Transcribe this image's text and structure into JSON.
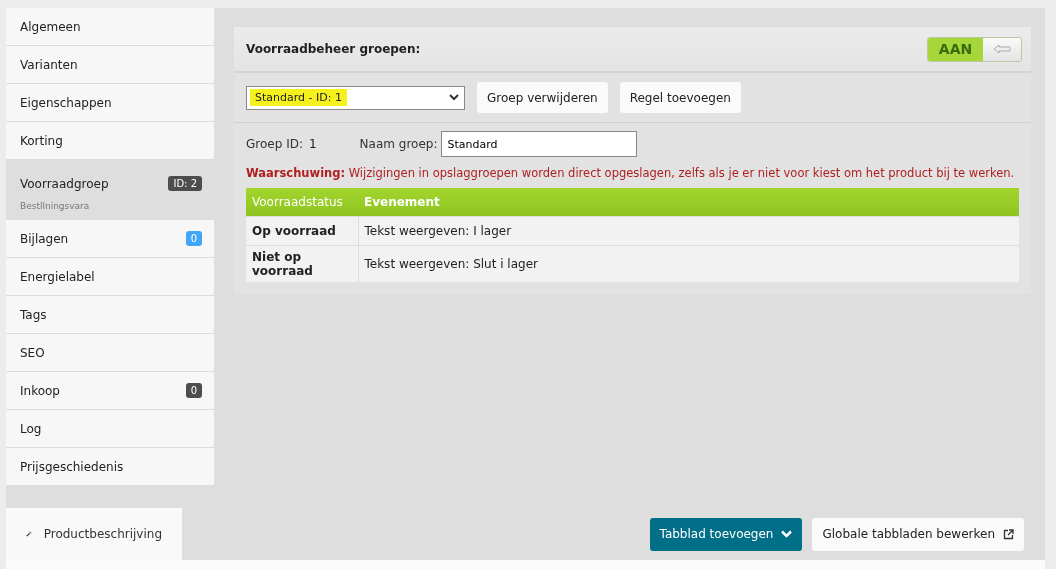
{
  "sidebar": {
    "items": [
      {
        "label": "Algemeen",
        "selected": false
      },
      {
        "label": "Varianten",
        "selected": false
      },
      {
        "label": "Eigenschappen",
        "selected": false
      },
      {
        "label": "Korting",
        "selected": false
      },
      {
        "label": "Voorraadgroep",
        "selected": true,
        "badge": "ID: 2",
        "color": "#4d4d4d",
        "subtitle": "Bestllningsvara"
      },
      {
        "label": "Bijlagen",
        "selected": false,
        "badge": "0",
        "color": "#42a5f5"
      },
      {
        "label": "Energielabel",
        "selected": false
      },
      {
        "label": "Tags",
        "selected": false
      },
      {
        "label": "SEO",
        "selected": false
      },
      {
        "label": "Inkoop",
        "selected": false,
        "badge": "0",
        "color": "#4d4d4d"
      },
      {
        "label": "Log",
        "selected": false
      },
      {
        "label": "Prijsgeschiedenis",
        "selected": false
      }
    ]
  },
  "panel": {
    "title": "Voorraadbeheer groepen:",
    "toggle": {
      "label": "AAN",
      "on": true
    },
    "group_select": {
      "value": "Standard - ID: 1",
      "highlighted": true
    },
    "buttons": [
      "Groep verwijderen",
      "Regel toevoegen"
    ],
    "group_id_label": "Groep ID:",
    "group_id": "1",
    "name_label": "Naam groep:",
    "name_value": "Standard",
    "warning": "**Waarschuwing:** Wijzigingen in opslaggroepen worden direct opgeslagen, zelfs als je er niet voor kiest om het product bij te werken.",
    "table": {
      "columns": [
        "Voorraadstatus",
        "Evenement"
      ],
      "rows": [
        [
          "Op voorraad",
          "Tekst weergeven: I lager"
        ],
        [
          "Niet op voorraad",
          "Tekst weergeven: Slut i lager"
        ]
      ]
    }
  },
  "bottom_tabs": [
    {
      "label": "Productbeschrijving",
      "selected": true
    }
  ],
  "bottom_buttons": [
    {
      "label": "Tabblad toevoegen",
      "kind": "primary"
    },
    {
      "label": "Globale tabbladen bewerken",
      "kind": "external"
    }
  ]
}
